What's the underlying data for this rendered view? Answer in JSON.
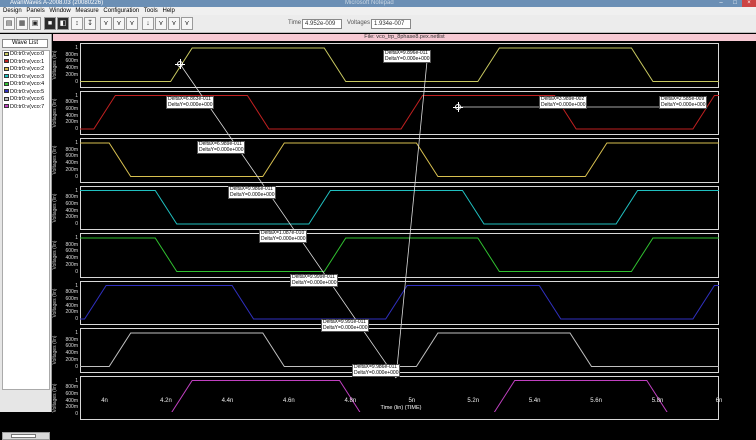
{
  "window": {
    "title": "AvanWaves A-2008.03 (20080226)",
    "ghost_title": "Microsoft Notepad"
  },
  "menu": [
    "Design",
    "Panels",
    "Window",
    "Measure",
    "Configuration",
    "Tools",
    "Help"
  ],
  "toolbar": {
    "time_label": "Time",
    "time_value": "4.952e-009",
    "voltage_label": "Voltages",
    "voltage_value": "1.934e-007"
  },
  "wave_list": {
    "title": "Wave List",
    "items": [
      {
        "label": "D0:tr0:v(vco:0",
        "color": "#c8c860"
      },
      {
        "label": "D0:tr0:v(vco:1",
        "color": "#c02020"
      },
      {
        "label": "D0:tr0:v(vco:2",
        "color": "#d8c050"
      },
      {
        "label": "D0:tr0:v(vco:3",
        "color": "#20c0c0"
      },
      {
        "label": "D0:tr0:v(vco:4",
        "color": "#30c030"
      },
      {
        "label": "D0:tr0:v(vco:5",
        "color": "#3030c0"
      },
      {
        "label": "D0:tr0:v(vco:6",
        "color": "#c0c0c0"
      },
      {
        "label": "D0:tr0:v(vco:7",
        "color": "#c040c0"
      }
    ]
  },
  "file_header": "File: vco_trp_8phase8.pex.netlist",
  "chart_data": {
    "type": "line",
    "xlabel": "Time (lin) (TIME)",
    "ylabel": "Voltages (lin)",
    "x_ticks": [
      "4n",
      "4.2n",
      "4.4n",
      "4.6n",
      "4.8n",
      "5n",
      "5.2n",
      "5.4n",
      "5.6n",
      "5.8n",
      "6n"
    ],
    "xlim": [
      3.92e-09,
      6e-09
    ],
    "ylim": [
      0,
      1.1
    ],
    "y_ticks": [
      "1",
      "800m",
      "600m",
      "400m",
      "200m",
      "0"
    ],
    "series": [
      {
        "name": "D0:tr0:v(vco:0",
        "color": "#c8c860",
        "edges": [
          [
            4.25e-09,
            1
          ],
          [
            4.75e-09,
            0
          ],
          [
            5.25e-09,
            1
          ],
          [
            5.75e-09,
            0
          ]
        ],
        "initial": 0
      },
      {
        "name": "D0:tr0:v(vco:1",
        "color": "#c02020",
        "edges": [
          [
            4e-09,
            1
          ],
          [
            4.5e-09,
            0
          ],
          [
            5e-09,
            1
          ],
          [
            5.5e-09,
            0
          ],
          [
            5.95e-09,
            1
          ]
        ],
        "initial": 0
      },
      {
        "name": "D0:tr0:v(vco:2",
        "color": "#d8c050",
        "edges": [
          [
            4.05e-09,
            0
          ],
          [
            4.55e-09,
            1
          ],
          [
            5.05e-09,
            0
          ],
          [
            5.6e-09,
            1
          ]
        ],
        "initial": 1
      },
      {
        "name": "D0:tr0:v(vco:3",
        "color": "#20c0c0",
        "edges": [
          [
            4.2e-09,
            0
          ],
          [
            4.7e-09,
            1
          ],
          [
            5.2e-09,
            0
          ],
          [
            5.7e-09,
            1
          ]
        ],
        "initial": 1
      },
      {
        "name": "D0:tr0:v(vco:4",
        "color": "#30c030",
        "edges": [
          [
            4.2e-09,
            0
          ],
          [
            4.75e-09,
            1
          ],
          [
            5.25e-09,
            0
          ],
          [
            5.75e-09,
            1
          ]
        ],
        "initial": 1
      },
      {
        "name": "D0:tr0:v(vco:5",
        "color": "#3030c0",
        "edges": [
          [
            3.97e-09,
            1
          ],
          [
            4.45e-09,
            0
          ],
          [
            4.95e-09,
            1
          ],
          [
            5.45e-09,
            0
          ],
          [
            5.95e-09,
            1
          ]
        ],
        "initial": 0
      },
      {
        "name": "D0:tr0:v(vco:6",
        "color": "#c0c0c0",
        "edges": [
          [
            4.05e-09,
            1
          ],
          [
            4.55e-09,
            0
          ],
          [
            5.05e-09,
            1
          ],
          [
            5.55e-09,
            0
          ]
        ],
        "initial": 0
      },
      {
        "name": "D0:tr0:v(vco:7",
        "color": "#c040c0",
        "edges": [
          [
            4.25e-09,
            1
          ],
          [
            4.8e-09,
            0
          ],
          [
            5.3e-09,
            1
          ],
          [
            5.8e-09,
            0
          ]
        ],
        "initial": 0
      }
    ]
  },
  "markers": [
    {
      "line1": "DeltaX=9.896e-011",
      "line2": "DeltaY=0.000e+000"
    },
    {
      "line1": "DeltaX=6.863e-011",
      "line2": "DeltaY=0.000e+000"
    },
    {
      "line1": "DeltaX=3.989e-002",
      "line2": "DeltaY=0.000e+000"
    },
    {
      "line1": "DeltaX=2.585e-009",
      "line2": "DeltaY=0.000e+000"
    },
    {
      "line1": "DeltaX=6.989e-011",
      "line2": "DeltaY=0.000e+000"
    },
    {
      "line1": "DeltaX=9.986e-011",
      "line2": "DeltaY=0.000e+000"
    },
    {
      "line1": "DeltaX=1.087e-010",
      "line2": "DeltaY=0.000e+000"
    },
    {
      "line1": "DeltaX=9.999e-011",
      "line2": "DeltaY=0.000e+000"
    },
    {
      "line1": "DeltaX=9.991e-011",
      "line2": "DeltaY=0.000e+000"
    },
    {
      "line1": "DeltaX=9.986e-011",
      "line2": "DeltaY=0.000e+000"
    }
  ]
}
